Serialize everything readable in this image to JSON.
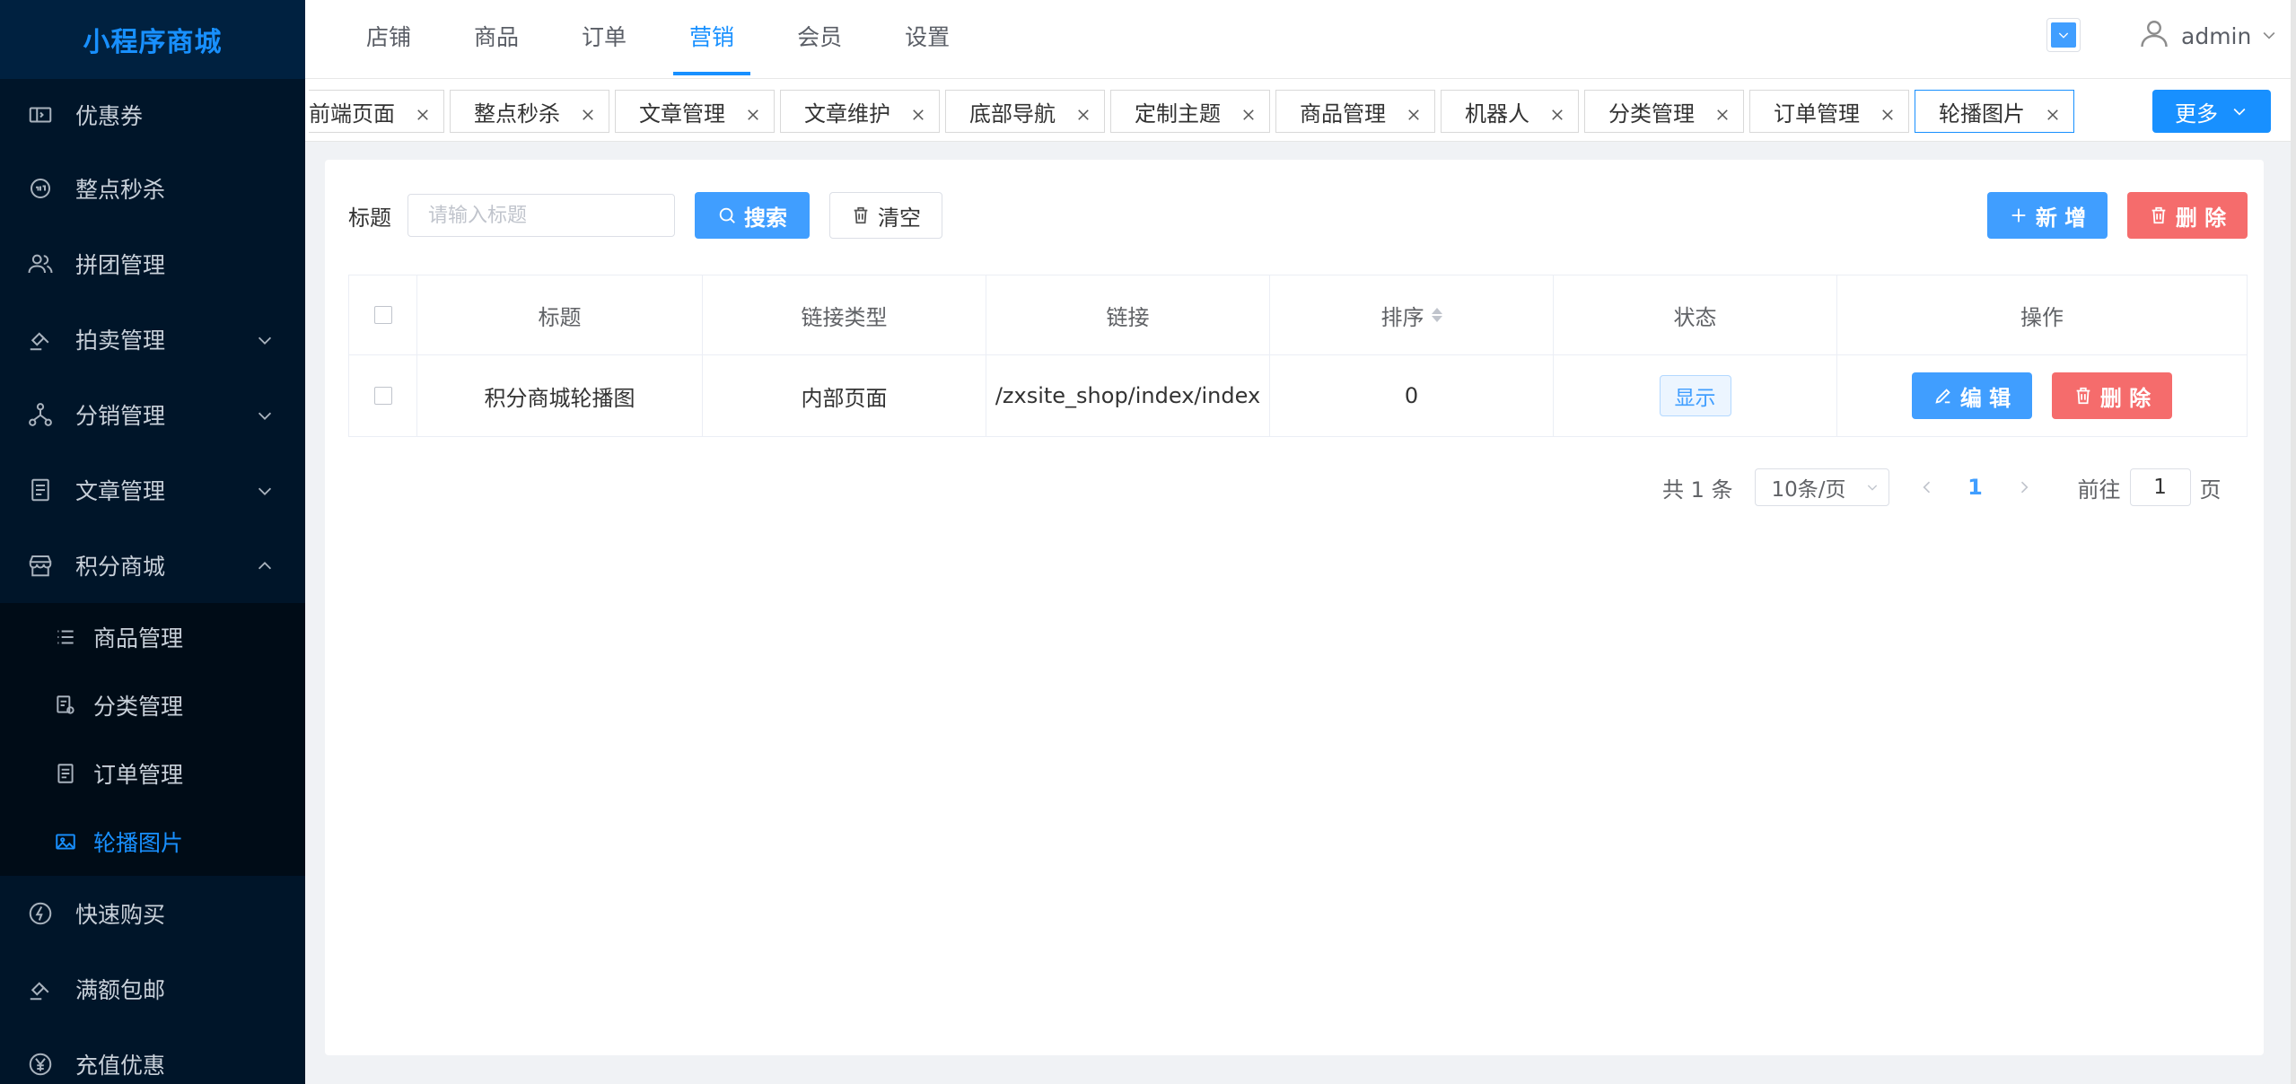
{
  "app": {
    "title": "小程序商城"
  },
  "sidebar": {
    "items": [
      {
        "label": "优惠券",
        "icon": "ticket-icon"
      },
      {
        "label": "整点秒杀",
        "icon": "flash-sale-icon"
      },
      {
        "label": "拼团管理",
        "icon": "group-icon"
      },
      {
        "label": "拍卖管理",
        "icon": "gavel-icon",
        "expandable": true
      },
      {
        "label": "分销管理",
        "icon": "network-icon",
        "expandable": true
      },
      {
        "label": "文章管理",
        "icon": "document-icon",
        "expandable": true
      },
      {
        "label": "积分商城",
        "icon": "store-icon",
        "expanded": true
      }
    ],
    "submenu": [
      {
        "label": "商品管理",
        "icon": "list-icon"
      },
      {
        "label": "分类管理",
        "icon": "category-icon"
      },
      {
        "label": "订单管理",
        "icon": "order-icon"
      },
      {
        "label": "轮播图片",
        "icon": "image-icon",
        "active": true
      }
    ],
    "items_after": [
      {
        "label": "快速购买",
        "icon": "lightning-icon"
      },
      {
        "label": "满额包邮",
        "icon": "gavel-icon"
      },
      {
        "label": "充值优惠",
        "icon": "yen-icon"
      }
    ]
  },
  "topnav": {
    "items": [
      "店铺",
      "商品",
      "订单",
      "营销",
      "会员",
      "设置"
    ],
    "active": "营销"
  },
  "user": {
    "name": "admin"
  },
  "theme": {
    "accent": "#409eff",
    "danger": "#f56c6c",
    "sidebar_bg": "#001529"
  },
  "tags": {
    "items": [
      "前端页面",
      "整点秒杀",
      "文章管理",
      "文章维护",
      "底部导航",
      "定制主题",
      "商品管理",
      "机器人",
      "分类管理",
      "订单管理",
      "轮播图片"
    ],
    "active": "轮播图片",
    "more_label": "更多"
  },
  "filter": {
    "title_label": "标题",
    "title_placeholder": "请输入标题",
    "title_value": "",
    "search_label": "搜索",
    "clear_label": "清空",
    "add_label": "新 增",
    "delete_label": "删 除"
  },
  "table": {
    "columns": [
      "标题",
      "链接类型",
      "链接",
      "排序",
      "状态",
      "操作"
    ],
    "rows": [
      {
        "title": "积分商城轮播图",
        "link_type": "内部页面",
        "link": "/zxsite_shop/index/index",
        "sort": "0",
        "status": "显示",
        "edit_label": "编 辑",
        "delete_label": "删 除"
      }
    ]
  },
  "pagination": {
    "total_text": "共 1 条",
    "page_size": "10条/页",
    "current_page": "1",
    "goto_prefix": "前往",
    "goto_value": "1",
    "goto_suffix": "页"
  }
}
